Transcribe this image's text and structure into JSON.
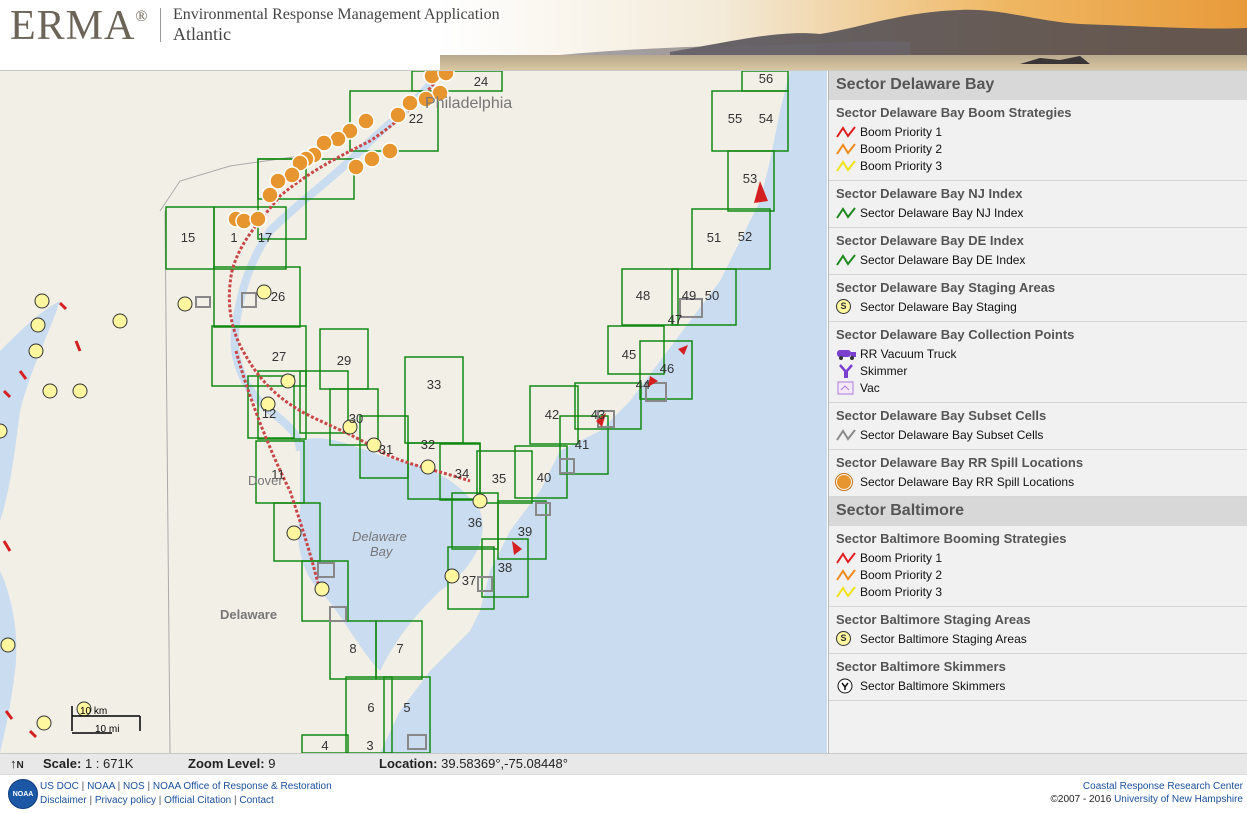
{
  "header": {
    "logo": "ERMA",
    "logo_mark": "®",
    "title": "Environmental Response Management Application",
    "subtitle": "Atlantic"
  },
  "map": {
    "place_labels": {
      "city": "Philadelphia",
      "dover": "Dover",
      "bay": "Delaware Bay",
      "state": "Delaware"
    },
    "grid_labels": [
      "56",
      "55",
      "54",
      "24",
      "22",
      "53",
      "52",
      "51",
      "15",
      "17",
      "26",
      "50",
      "49",
      "48",
      "47",
      "45",
      "46",
      "29",
      "27",
      "33",
      "43",
      "42",
      "44",
      "30",
      "31",
      "32",
      "34",
      "35",
      "41",
      "40",
      "39",
      "36",
      "37",
      "38",
      "11",
      "12",
      "8",
      "7",
      "6",
      "5",
      "4",
      "3",
      "1"
    ],
    "scalebar": {
      "km": "10 km",
      "mi": "10 mi"
    }
  },
  "status": {
    "north": "N",
    "scale_label": "Scale:",
    "scale_value": "1 : 671K",
    "zoom_label": "Zoom Level:",
    "zoom_value": "9",
    "location_label": "Location:",
    "location_value": "39.58369°,-75.08448°"
  },
  "footer": {
    "links_line1": [
      "US DOC",
      "NOAA",
      "NOS",
      "NOAA Office of Response & Restoration"
    ],
    "links_line2": [
      "Disclaimer",
      "Privacy policy",
      "Official Citation",
      "Contact"
    ],
    "right_line1": "Coastal Response Research Center",
    "right_line2_prefix": "©2007 - 2016",
    "right_line2_link": "University of New Hampshire",
    "noaa_badge": "NOAA"
  },
  "legend": {
    "sectors": [
      {
        "title": "Sector Delaware Bay",
        "groups": [
          {
            "title": "Sector Delaware Bay Boom Strategies",
            "items": [
              {
                "label": "Boom Priority 1",
                "icon": "line-red-icon",
                "color": "#e02020"
              },
              {
                "label": "Boom Priority 2",
                "icon": "line-orange-icon",
                "color": "#f08a1c"
              },
              {
                "label": "Boom Priority 3",
                "icon": "line-yellow-icon",
                "color": "#f2e21a"
              }
            ]
          },
          {
            "title": "Sector Delaware Bay NJ Index",
            "items": [
              {
                "label": "Sector Delaware Bay NJ Index",
                "icon": "line-green-icon",
                "color": "#1e8a1e"
              }
            ]
          },
          {
            "title": "Sector Delaware Bay DE Index",
            "items": [
              {
                "label": "Sector Delaware Bay DE Index",
                "icon": "line-green-icon",
                "color": "#1e8a1e"
              }
            ]
          },
          {
            "title": "Sector Delaware Bay Staging Areas",
            "items": [
              {
                "label": "Sector Delaware Bay Staging",
                "icon": "staging-coin-icon",
                "glyph": "S"
              }
            ]
          },
          {
            "title": "Sector Delaware Bay Collection Points",
            "items": [
              {
                "label": "RR Vacuum Truck",
                "icon": "vacuum-truck-icon",
                "color": "#7b3fd0"
              },
              {
                "label": "Skimmer",
                "icon": "skimmer-icon",
                "color": "#7b3fd0"
              },
              {
                "label": "Vac",
                "icon": "vac-icon",
                "color": "#b07ad8"
              }
            ]
          },
          {
            "title": "Sector Delaware Bay Subset Cells",
            "items": [
              {
                "label": "Sector Delaware Bay Subset Cells",
                "icon": "line-gray-icon",
                "color": "#8a8a8a"
              }
            ]
          },
          {
            "title": "Sector Delaware Bay RR Spill Locations",
            "items": [
              {
                "label": "Sector Delaware Bay RR Spill Locations",
                "icon": "spill-drum-icon",
                "color": "#e7952e"
              }
            ]
          }
        ]
      },
      {
        "title": "Sector Baltimore",
        "groups": [
          {
            "title": "Sector Baltimore Booming Strategies",
            "items": [
              {
                "label": "Boom Priority 1",
                "icon": "line-red-icon",
                "color": "#e02020"
              },
              {
                "label": "Boom Priority 2",
                "icon": "line-orange-icon",
                "color": "#f08a1c"
              },
              {
                "label": "Boom Priority 3",
                "icon": "line-yellow-icon",
                "color": "#f2e21a"
              }
            ]
          },
          {
            "title": "Sector Baltimore Staging Areas",
            "items": [
              {
                "label": "Sector Baltimore Staging Areas",
                "icon": "staging-coin-icon",
                "glyph": "S"
              }
            ]
          },
          {
            "title": "Sector Baltimore Skimmers",
            "items": [
              {
                "label": "Sector Baltimore Skimmers",
                "icon": "skimmer-black-icon",
                "color": "#111111"
              }
            ]
          }
        ]
      }
    ]
  }
}
